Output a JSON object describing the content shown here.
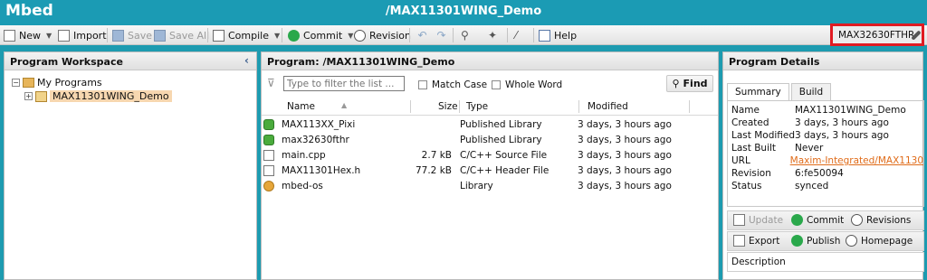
{
  "app": {
    "brand": "Mbed",
    "window_title": "/MAX11301WING_Demo"
  },
  "toolbar": {
    "new": "New",
    "import": "Import",
    "save": "Save",
    "save_all": "Save All",
    "compile": "Compile",
    "commit": "Commit",
    "revision": "Revision",
    "help": "Help"
  },
  "platform": {
    "name": "MAX32630FTHR"
  },
  "workspace": {
    "title": "Program Workspace",
    "tree": {
      "root": "My Programs",
      "child": "MAX11301WING_Demo"
    }
  },
  "program": {
    "title": "Program: /MAX11301WING_Demo",
    "filter_placeholder": "Type to filter the list ...",
    "match_case": "Match Case",
    "whole_word": "Whole Word",
    "find": "Find",
    "columns": {
      "name": "Name",
      "size": "Size",
      "type": "Type",
      "modified": "Modified"
    },
    "files": [
      {
        "name": "MAX113XX_Pixi",
        "size": "",
        "type": "Published Library",
        "modified": "3 days, 3 hours ago",
        "icon": "library-icon"
      },
      {
        "name": "max32630fthr",
        "size": "",
        "type": "Published Library",
        "modified": "3 days, 3 hours ago",
        "icon": "library-icon"
      },
      {
        "name": "main.cpp",
        "size": "2.7 kB",
        "type": "C/C++ Source File",
        "modified": "3 days, 3 hours ago",
        "icon": "file-icon"
      },
      {
        "name": "MAX11301Hex.h",
        "size": "77.2 kB",
        "type": "C/C++ Header File",
        "modified": "3 days, 3 hours ago",
        "icon": "file-icon"
      },
      {
        "name": "mbed-os",
        "size": "",
        "type": "Library",
        "modified": "3 days, 3 hours ago",
        "icon": "os-library-icon"
      }
    ]
  },
  "details": {
    "title": "Program Details",
    "tabs": [
      "Summary",
      "Build"
    ],
    "fields": [
      {
        "k": "Name",
        "v": "MAX11301WING_Demo"
      },
      {
        "k": "Created",
        "v": "3 days, 3 hours ago"
      },
      {
        "k": "Last Modified",
        "v": "3 days, 3 hours ago"
      },
      {
        "k": "Last Built",
        "v": "Never"
      },
      {
        "k": "URL",
        "v": "Maxim-Integrated/MAX1130"
      },
      {
        "k": "Revision",
        "v": "6:fe50094"
      },
      {
        "k": "Status",
        "v": "synced"
      }
    ],
    "actions1": {
      "update": "Update",
      "commit": "Commit",
      "revisions": "Revisions"
    },
    "actions2": {
      "export": "Export",
      "publish": "Publish",
      "homepage": "Homepage"
    },
    "description": "Description"
  }
}
